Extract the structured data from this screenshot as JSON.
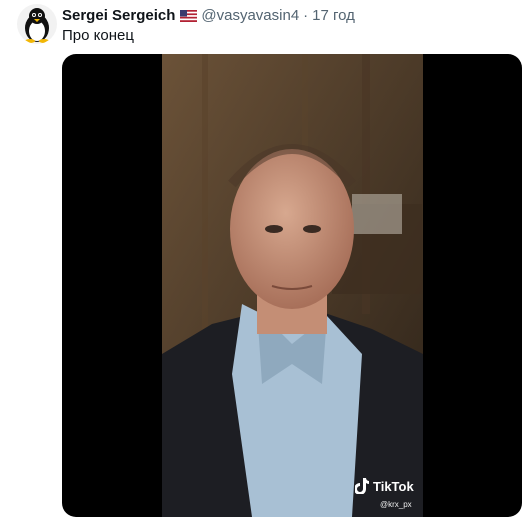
{
  "tweet": {
    "author_name": "Sergei Sergeich",
    "author_flag": "us-flag-icon",
    "handle": "@vasyavasin4",
    "separator": "·",
    "time": "17 год",
    "text": "Про конец"
  },
  "media": {
    "watermark_brand": "TikTok",
    "watermark_user": "@krx_px"
  },
  "colors": {
    "name": "#0f1419",
    "secondary": "#536471",
    "media_background": "#000000"
  }
}
